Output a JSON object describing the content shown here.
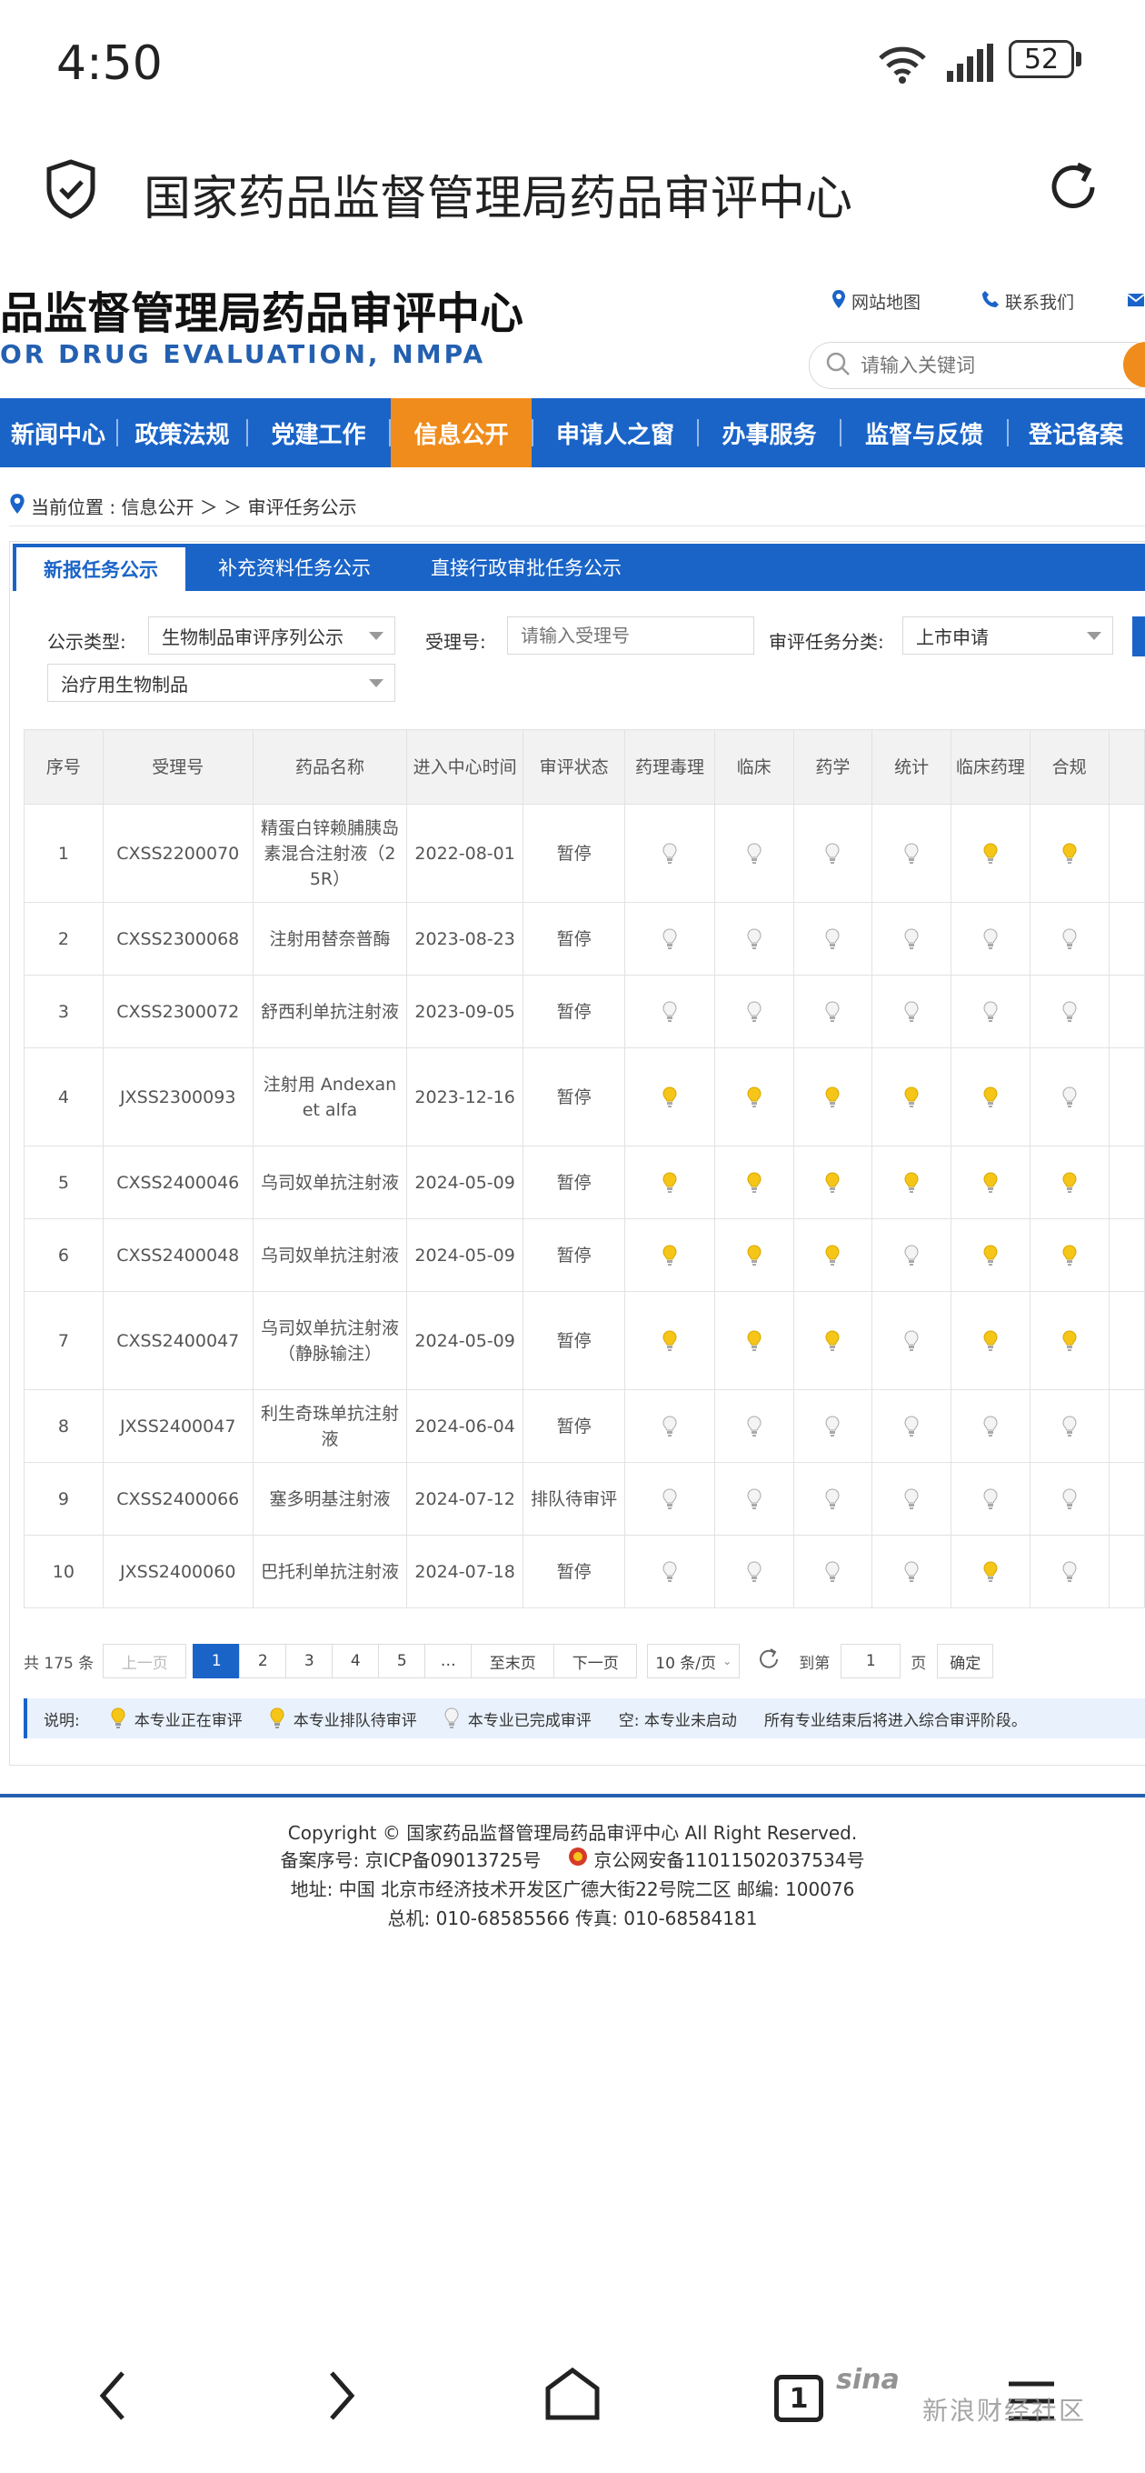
{
  "status_bar": {
    "time": "4:50",
    "battery": "52"
  },
  "browser": {
    "title": "国家药品监督管理局药品审评中心"
  },
  "header": {
    "title_cn": "品监督管理局药品审评中心",
    "title_en": "OR DRUG EVALUATION, NMPA",
    "sitemap": "网站地图",
    "contact": "联系我们",
    "search_placeholder": "请输入关键词"
  },
  "nav": {
    "items": [
      "新闻中心",
      "政策法规",
      "党建工作",
      "信息公开",
      "申请人之窗",
      "办事服务",
      "监督与反馈",
      "登记备案"
    ],
    "active_index": 3
  },
  "breadcrumb": {
    "text": "当前位置 : 信息公开 ＞ ＞ 审评任务公示"
  },
  "tabs": [
    "新报任务公示",
    "补充资料任务公示",
    "直接行政审批任务公示"
  ],
  "filters": {
    "type_label": "公示类型:",
    "type_value": "生物制品审评序列公示",
    "acceptance_label": "受理号:",
    "acceptance_placeholder": "请输入受理号",
    "category_label": "审评任务分类:",
    "category_value": "上市申请",
    "sub_value": "治疗用生物制品"
  },
  "table": {
    "headers": [
      "序号",
      "受理号",
      "药品名称",
      "进入中心时间",
      "审评状态",
      "药理毒理",
      "临床",
      "药学",
      "统计",
      "临床药理",
      "合规"
    ],
    "rows": [
      {
        "no": "1",
        "id": "CXSS2200070",
        "name": "精蛋白锌赖脯胰岛素混合注射液（25R）",
        "date": "2022-08-01",
        "status": "暂停",
        "lights": [
          "done",
          "done",
          "done",
          "done",
          "active",
          "active"
        ]
      },
      {
        "no": "2",
        "id": "CXSS2300068",
        "name": "注射用替奈普酶",
        "date": "2023-08-23",
        "status": "暂停",
        "lights": [
          "done",
          "done",
          "done",
          "done",
          "done",
          "done"
        ]
      },
      {
        "no": "3",
        "id": "CXSS2300072",
        "name": "舒西利单抗注射液",
        "date": "2023-09-05",
        "status": "暂停",
        "lights": [
          "done",
          "done",
          "done",
          "done",
          "done",
          "done"
        ]
      },
      {
        "no": "4",
        "id": "JXSS2300093",
        "name": "注射用 Andexanet alfa",
        "date": "2023-12-16",
        "status": "暂停",
        "lights": [
          "active",
          "active",
          "active",
          "active",
          "active",
          "done"
        ]
      },
      {
        "no": "5",
        "id": "CXSS2400046",
        "name": "乌司奴单抗注射液",
        "date": "2024-05-09",
        "status": "暂停",
        "lights": [
          "active",
          "active",
          "active",
          "active",
          "active",
          "active"
        ]
      },
      {
        "no": "6",
        "id": "CXSS2400048",
        "name": "乌司奴单抗注射液",
        "date": "2024-05-09",
        "status": "暂停",
        "lights": [
          "active",
          "active",
          "active",
          "done",
          "active",
          "active"
        ]
      },
      {
        "no": "7",
        "id": "CXSS2400047",
        "name": "乌司奴单抗注射液（静脉输注）",
        "date": "2024-05-09",
        "status": "暂停",
        "lights": [
          "active",
          "active",
          "active",
          "done",
          "active",
          "active"
        ]
      },
      {
        "no": "8",
        "id": "JXSS2400047",
        "name": "利生奇珠单抗注射液",
        "date": "2024-06-04",
        "status": "暂停",
        "lights": [
          "done",
          "done",
          "done",
          "done",
          "done",
          "done"
        ]
      },
      {
        "no": "9",
        "id": "CXSS2400066",
        "name": "塞多明基注射液",
        "date": "2024-07-12",
        "status": "排队待审评",
        "lights": [
          "done",
          "done",
          "done",
          "done",
          "done",
          "done"
        ]
      },
      {
        "no": "10",
        "id": "JXSS2400060",
        "name": "巴托利单抗注射液",
        "date": "2024-07-18",
        "status": "暂停",
        "lights": [
          "done",
          "done",
          "done",
          "done",
          "active",
          "done"
        ]
      }
    ]
  },
  "pager": {
    "total": "共 175 条",
    "prev": "上一页",
    "pages": [
      "1",
      "2",
      "3",
      "4",
      "5",
      "…"
    ],
    "last": "至末页",
    "next": "下一页",
    "page_size": "10 条/页",
    "goto_label": "到第",
    "goto_value": "1",
    "page_unit": "页",
    "confirm": "确定"
  },
  "legend": {
    "label": "说明:",
    "active": "本专业正在审评",
    "queued": "本专业排队待审评",
    "done": "本专业已完成审评",
    "empty": "空: 本专业未启动",
    "note": "所有专业结束后将进入综合审评阶段。"
  },
  "footer": {
    "copyright": "Copyright © 国家药品监督管理局药品审评中心   All Right Reserved.",
    "icp": "备案序号: 京ICP备09013725号",
    "police": "京公网安备11011502037534号",
    "address": "地址:  中国 北京市经济技术开发区广德大街22号院二区       邮编:  100076",
    "phone": "总机:  010-68585566       传真:  010-68584181"
  },
  "bottom_nav": {
    "tab_count": "1",
    "watermark_logo": "sina",
    "watermark_text": "新浪财经社区"
  },
  "colors": {
    "brand_blue": "#1a64c8",
    "accent_orange": "#f08c1c",
    "bulb_active": "#f5c518",
    "bulb_done": "#cfcfcf"
  }
}
